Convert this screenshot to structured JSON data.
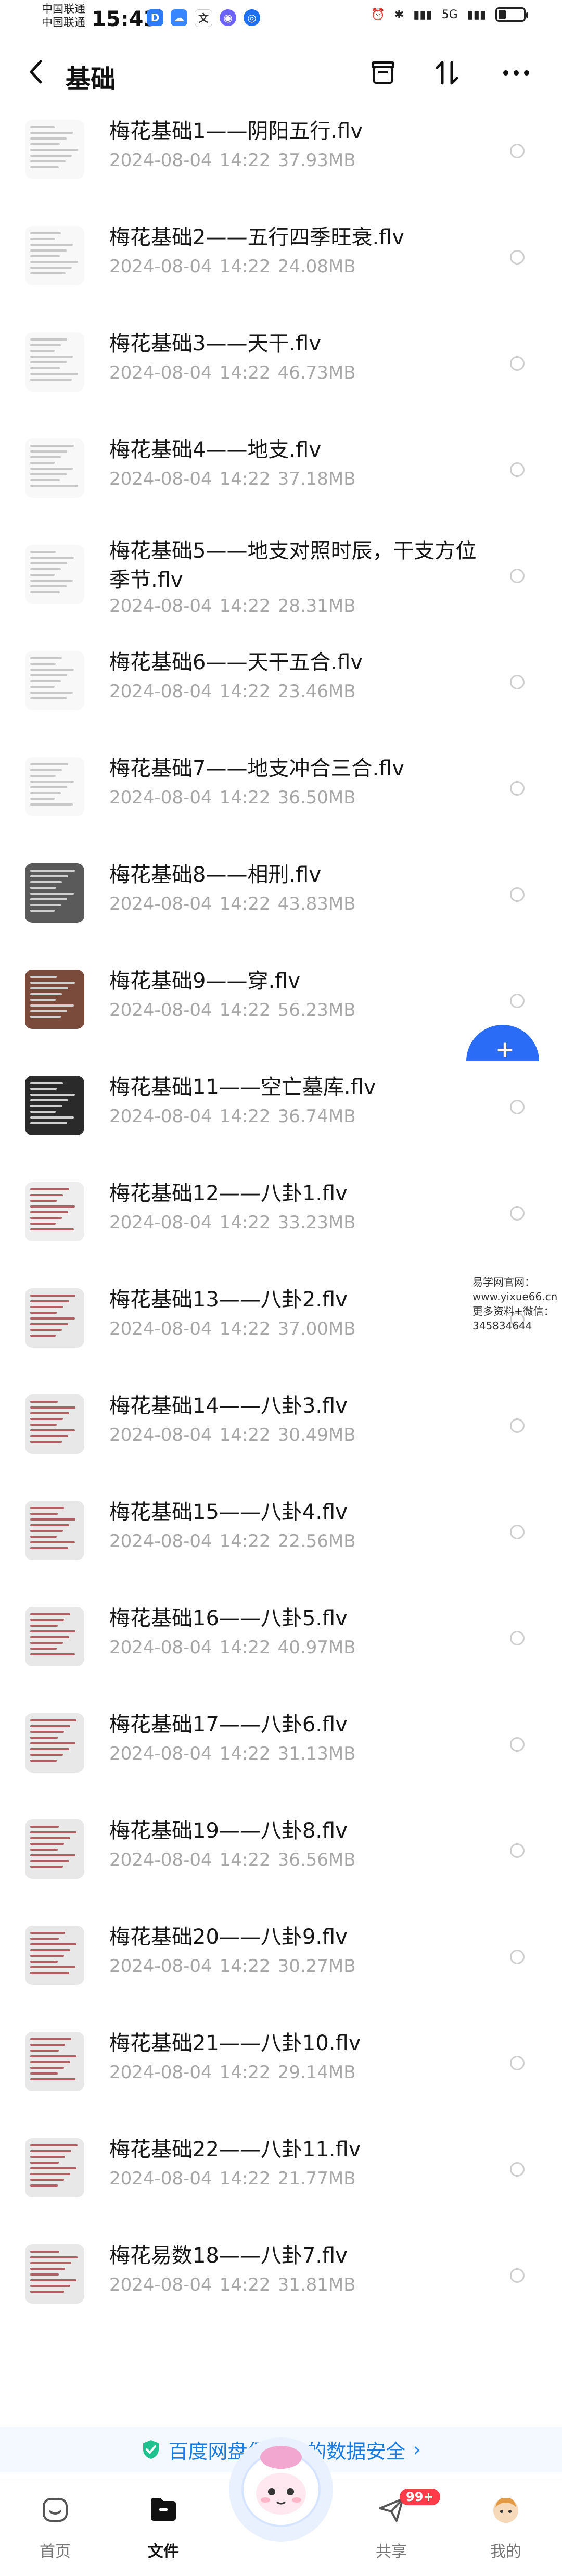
{
  "status_bar": {
    "carrier_1": "中国联通",
    "carrier_2": "中国联通",
    "time": "15:43",
    "signal_text": "5G"
  },
  "header": {
    "title": "基础"
  },
  "files": [
    {
      "name": "梅花基础1——阴阳五行.flv",
      "date": "2024-08-04",
      "time": "14:22",
      "size": "37.93MB"
    },
    {
      "name": "梅花基础2——五行四季旺衰.flv",
      "date": "2024-08-04",
      "time": "14:22",
      "size": "24.08MB"
    },
    {
      "name": "梅花基础3——天干.flv",
      "date": "2024-08-04",
      "time": "14:22",
      "size": "46.73MB"
    },
    {
      "name": "梅花基础4——地支.flv",
      "date": "2024-08-04",
      "time": "14:22",
      "size": "37.18MB"
    },
    {
      "name": "梅花基础5——地支对照时辰，干支方位季节.flv",
      "date": "2024-08-04",
      "time": "14:22",
      "size": "28.31MB"
    },
    {
      "name": "梅花基础6——天干五合.flv",
      "date": "2024-08-04",
      "time": "14:22",
      "size": "23.46MB"
    },
    {
      "name": "梅花基础7——地支冲合三合.flv",
      "date": "2024-08-04",
      "time": "14:22",
      "size": "36.50MB"
    },
    {
      "name": "梅花基础8——相刑.flv",
      "date": "2024-08-04",
      "time": "14:22",
      "size": "43.83MB"
    },
    {
      "name": "梅花基础9——穿.flv",
      "date": "2024-08-04",
      "time": "14:22",
      "size": "56.23MB"
    },
    {
      "name": "梅花基础11——空亡墓库.flv",
      "date": "2024-08-04",
      "time": "14:22",
      "size": "36.74MB"
    },
    {
      "name": "梅花基础12——八卦1.flv",
      "date": "2024-08-04",
      "time": "14:22",
      "size": "33.23MB"
    },
    {
      "name": "梅花基础13——八卦2.flv",
      "date": "2024-08-04",
      "time": "14:22",
      "size": "37.00MB"
    },
    {
      "name": "梅花基础14——八卦3.flv",
      "date": "2024-08-04",
      "time": "14:22",
      "size": "30.49MB"
    },
    {
      "name": "梅花基础15——八卦4.flv",
      "date": "2024-08-04",
      "time": "14:22",
      "size": "22.56MB"
    },
    {
      "name": "梅花基础16——八卦5.flv",
      "date": "2024-08-04",
      "time": "14:22",
      "size": "40.97MB"
    },
    {
      "name": "梅花基础17——八卦6.flv",
      "date": "2024-08-04",
      "time": "14:22",
      "size": "31.13MB"
    },
    {
      "name": "梅花基础19——八卦8.flv",
      "date": "2024-08-04",
      "time": "14:22",
      "size": "36.56MB"
    },
    {
      "name": "梅花基础20——八卦9.flv",
      "date": "2024-08-04",
      "time": "14:22",
      "size": "30.27MB"
    },
    {
      "name": "梅花基础21——八卦10.flv",
      "date": "2024-08-04",
      "time": "14:22",
      "size": "29.14MB"
    },
    {
      "name": "梅花基础22——八卦11.flv",
      "date": "2024-08-04",
      "time": "14:22",
      "size": "21.77MB"
    },
    {
      "name": "梅花易数18——八卦7.flv",
      "date": "2024-08-04",
      "time": "14:22",
      "size": "31.81MB"
    }
  ],
  "watermark": {
    "line1": "易学网官网：www.yixue66.cn",
    "line2": "更多资料+微信：345834644"
  },
  "security_banner": {
    "text": "百度网盘保障你的数据安全",
    "arrow": "›"
  },
  "tabbar": {
    "tabs": [
      {
        "label": "首页",
        "icon": "home-icon"
      },
      {
        "label": "文件",
        "icon": "folder-icon"
      },
      {
        "label": "共享",
        "icon": "send-icon"
      },
      {
        "label": "我的",
        "icon": "avatar-icon"
      }
    ],
    "share_badge": "99+"
  },
  "colors": {
    "accent": "#2a6cf6",
    "security_text": "#1a7be0",
    "meta_gray": "#a7a7a7",
    "badge_red": "#ff3b4a"
  }
}
